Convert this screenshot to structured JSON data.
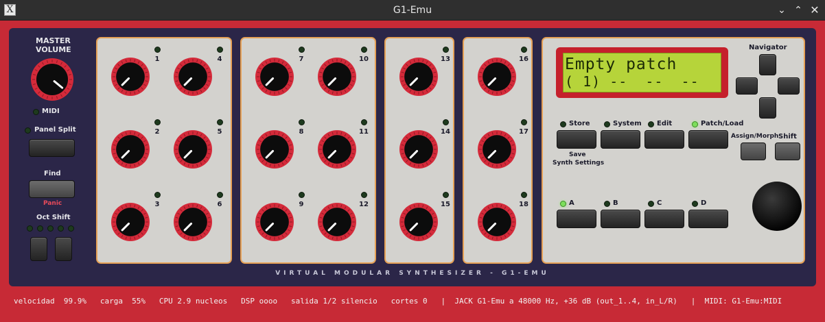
{
  "window": {
    "title": "G1-Emu",
    "icon": "x-icon",
    "controls": {
      "minimize": "⌄",
      "maximize": "⌃",
      "close": "✕"
    }
  },
  "left": {
    "master_volume_line1": "MASTER",
    "master_volume_line2": "VOLUME",
    "midi_label": "MIDI",
    "panel_split_label": "Panel Split",
    "find_label": "Find",
    "panic_label": "Panic",
    "oct_shift_label": "Oct Shift",
    "oct_leds": 5
  },
  "knob_groups": [
    {
      "knobs": [
        "1",
        "4",
        "2",
        "5",
        "3",
        "6"
      ]
    },
    {
      "knobs": [
        "7",
        "10",
        "8",
        "11",
        "9",
        "12"
      ]
    },
    {
      "knobs": [
        "13",
        "14",
        "15"
      ]
    },
    {
      "knobs": [
        "16",
        "17",
        "18"
      ]
    }
  ],
  "lcd": {
    "line1": "Empty patch",
    "line2": "( 1) --  --  --",
    "background": "#b6d43a"
  },
  "navigator": {
    "label": "Navigator"
  },
  "function_buttons": [
    {
      "label": "Store",
      "led_on": false
    },
    {
      "label": "System",
      "led_on": false
    },
    {
      "label": "Edit",
      "led_on": false
    },
    {
      "label": "Patch/Load",
      "led_on": true
    }
  ],
  "store_sublabel_1": "Save",
  "store_sublabel_2": "Synth Settings",
  "assign_morph_label": "Assign/Morph",
  "shift_label": "Shift",
  "slot_buttons": [
    {
      "label": "A",
      "led_on": true
    },
    {
      "label": "B",
      "led_on": false
    },
    {
      "label": "C",
      "led_on": false
    },
    {
      "label": "D",
      "led_on": false
    }
  ],
  "footer_caption": "VIRTUAL  MODULAR  SYNTHESIZER  -  G1-EMU",
  "statusbar": "velocidad  99.9%   carga  55%   CPU 2.9 nucleos   DSP oooo   salida 1/2 silencio   cortes 0   |  JACK G1-Emu a 48000 Hz, +36 dB (out_1..4, in_L/R)   |  MIDI: G1-Emu:MIDI",
  "colors": {
    "body_red": "#c72a36",
    "inner_navy": "#2b2648",
    "panel_gray": "#d3d2ce",
    "panel_border": "#e6a055",
    "knob_ring_red": "#d42a3a",
    "lcd_green": "#b6d43a",
    "led_on": "#7dde5c"
  }
}
